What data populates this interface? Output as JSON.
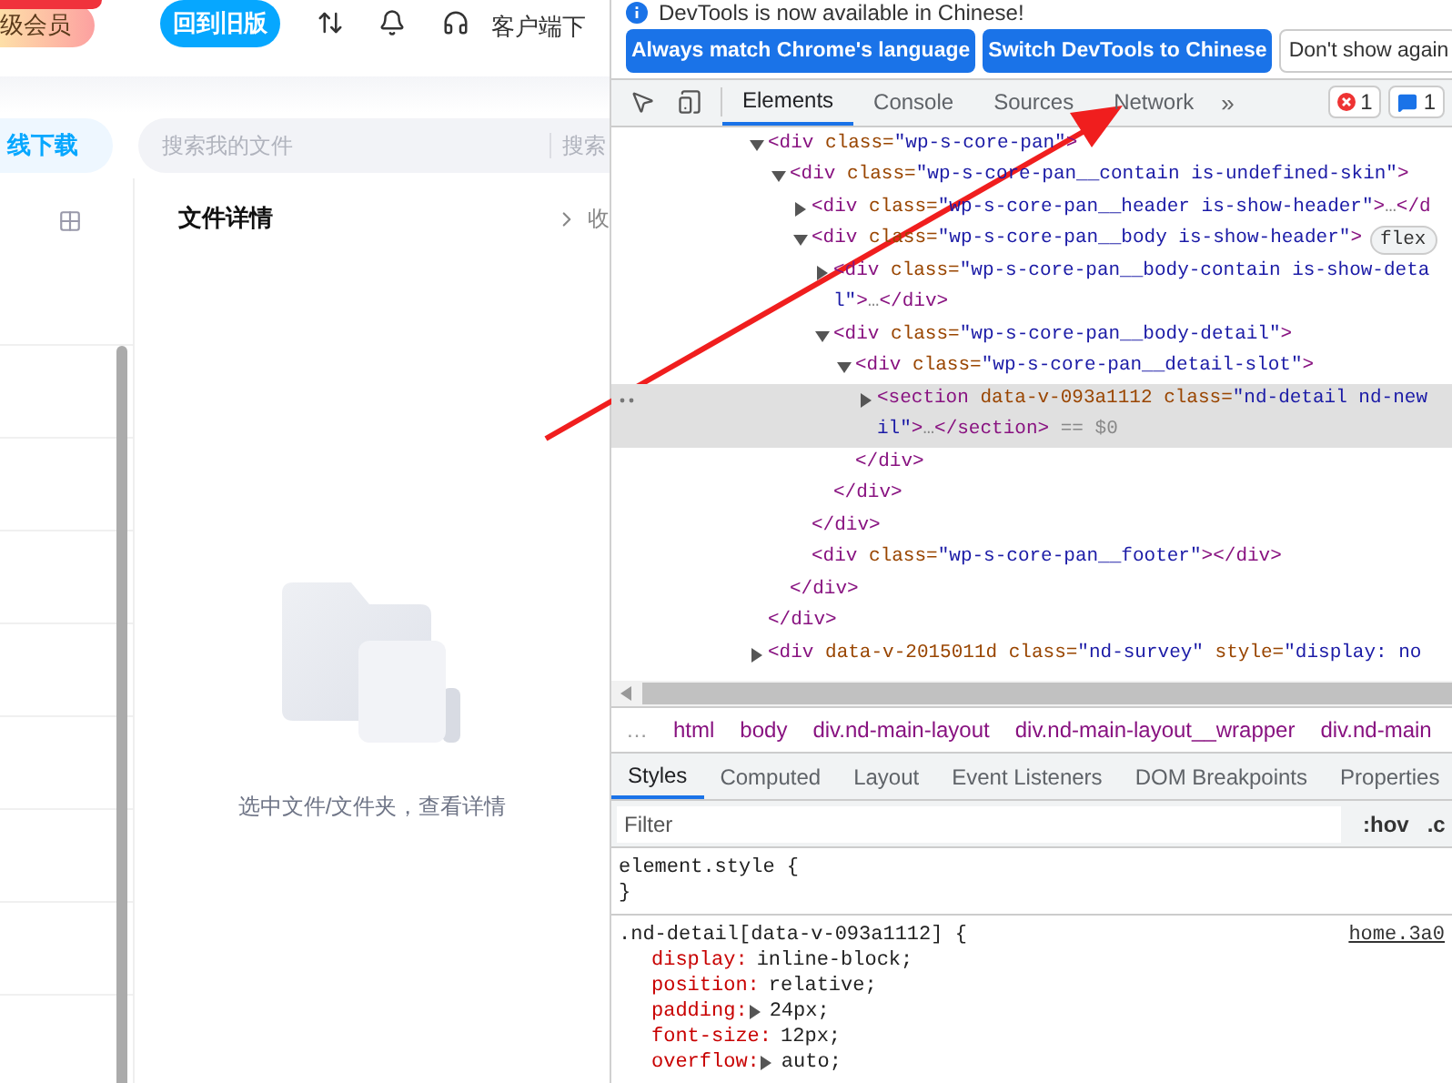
{
  "page": {
    "member_badge": "级会员",
    "old_version_button": "回到旧版",
    "client_download": "客户端下",
    "offline_download_button": "线下载",
    "search": {
      "placeholder": "搜索我的文件",
      "button": "搜索"
    },
    "detail_panel": {
      "title": "文件详情",
      "collapse_label": "收",
      "empty_text": "选中文件/文件夹，查看详情"
    }
  },
  "devtools": {
    "notice": "DevTools is now available in Chinese!",
    "notice_buttons": [
      {
        "label": "Always match Chrome's language",
        "kind": "primary"
      },
      {
        "label": "Switch DevTools to Chinese",
        "kind": "primary"
      },
      {
        "label": "Don't show again",
        "kind": "secondary"
      }
    ],
    "tabs": [
      {
        "label": "Elements",
        "selected": true
      },
      {
        "label": "Console",
        "selected": false
      },
      {
        "label": "Sources",
        "selected": false
      },
      {
        "label": "Network",
        "selected": false
      }
    ],
    "more_tabs": "»",
    "error_count": "1",
    "message_count": "1",
    "dom_tree": [
      {
        "open": "<div class=\"wp-s-core-pan\">",
        "expanded": true,
        "selected": false,
        "close": "</div>",
        "children": [
          {
            "open": "<div class=\"wp-s-core-pan__contain  is-undefined-skin\">",
            "expanded": true,
            "selected": false,
            "close": "</div>",
            "children": [
              {
                "open": "<div class=\"wp-s-core-pan__header is-show-header\">…</d",
                "expanded": false,
                "selected": false
              },
              {
                "open": "<div class=\"wp-s-core-pan__body is-show-header\">",
                "badge": "flex",
                "expanded": true,
                "selected": false,
                "close": "</div>",
                "children": [
                  {
                    "open": "<div class=\"wp-s-core-pan__body-contain is-show-deta",
                    "wrap": "l\">…</div>",
                    "expanded": false,
                    "selected": false
                  },
                  {
                    "open": "<div class=\"wp-s-core-pan__body-detail\">",
                    "expanded": true,
                    "selected": false,
                    "close": "</div>",
                    "children": [
                      {
                        "open": "<div class=\"wp-s-core-pan__detail-slot\">",
                        "expanded": true,
                        "selected": false,
                        "close": "</div>",
                        "children": [
                          {
                            "open": "<section data-v-093a1112 class=\"nd-detail nd-new",
                            "wrap": "il\">…</section> == $0",
                            "expanded": false,
                            "selected": true
                          }
                        ]
                      }
                    ]
                  }
                ]
              },
              {
                "open": "<div class=\"wp-s-core-pan__footer\"></div>",
                "selected": false
              }
            ]
          }
        ]
      },
      {
        "open": "<div data-v-2015011d class=\"nd-survey\" style=\"display: no",
        "expanded": false,
        "selected": false
      }
    ],
    "breadcrumb_more": "…",
    "breadcrumbs": [
      "html",
      "body",
      "div.nd-main-layout",
      "div.nd-main-layout__wrapper",
      "div.nd-main"
    ],
    "sub_tabs": [
      {
        "label": "Styles",
        "selected": true
      },
      {
        "label": "Computed",
        "selected": false
      },
      {
        "label": "Layout",
        "selected": false
      },
      {
        "label": "Event Listeners",
        "selected": false
      },
      {
        "label": "DOM Breakpoints",
        "selected": false
      },
      {
        "label": "Properties",
        "selected": false
      }
    ],
    "filter": {
      "placeholder": "Filter",
      "hov": ":hov",
      "cls": ".c"
    },
    "rules": [
      {
        "selector": "element.style {",
        "close": "}"
      },
      {
        "selector": ".nd-detail[data-v-093a1112] {",
        "source": "home.3a0",
        "properties": [
          {
            "name": "display:",
            "value": "inline-block;",
            "expandable": false
          },
          {
            "name": "position:",
            "value": "relative;",
            "expandable": false
          },
          {
            "name": "padding:",
            "value": "24px;",
            "expandable": true
          },
          {
            "name": "font-size:",
            "value": "12px;",
            "expandable": false
          },
          {
            "name": "overflow:",
            "value": "auto;",
            "expandable": true
          }
        ]
      }
    ]
  }
}
